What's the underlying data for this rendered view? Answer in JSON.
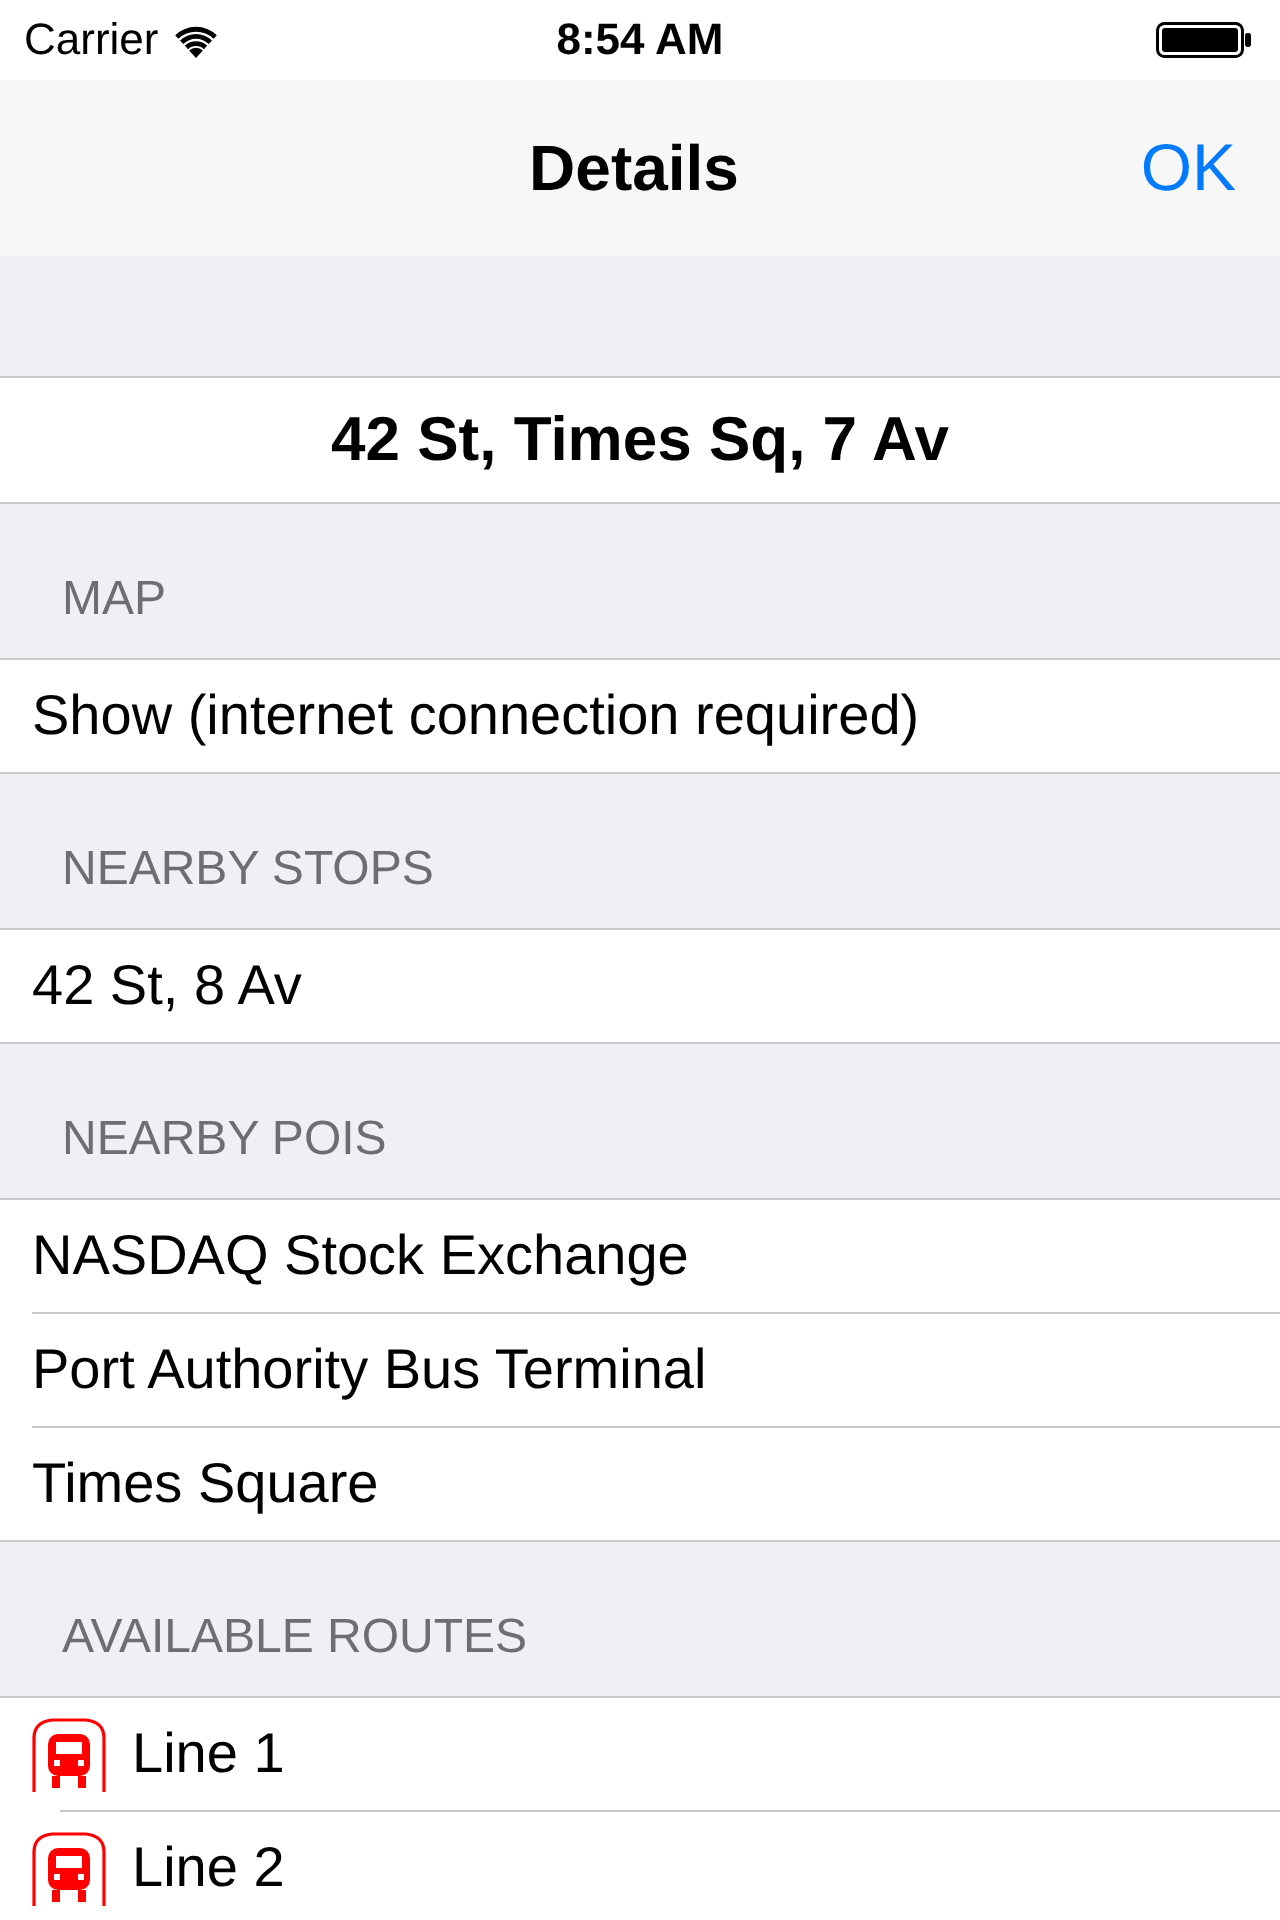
{
  "status_bar": {
    "carrier": "Carrier",
    "time": "8:54 AM"
  },
  "nav_bar": {
    "title": "Details",
    "right_button": "OK"
  },
  "stop_title": "42 St, Times Sq, 7 Av",
  "sections": [
    {
      "header": "MAP",
      "rows": [
        {
          "kind": "plain",
          "label": "Show (internet connection required)"
        }
      ]
    },
    {
      "header": "NEARBY STOPS",
      "rows": [
        {
          "kind": "plain",
          "label": "42 St, 8 Av"
        }
      ]
    },
    {
      "header": "NEARBY POIS",
      "rows": [
        {
          "kind": "plain",
          "label": "NASDAQ Stock Exchange"
        },
        {
          "kind": "plain",
          "label": "Port Authority Bus Terminal"
        },
        {
          "kind": "plain",
          "label": "Times Square"
        }
      ]
    },
    {
      "header": "AVAILABLE ROUTES",
      "rows": [
        {
          "kind": "route",
          "label": "Line 1"
        },
        {
          "kind": "route",
          "label": "Line 2"
        }
      ]
    }
  ]
}
